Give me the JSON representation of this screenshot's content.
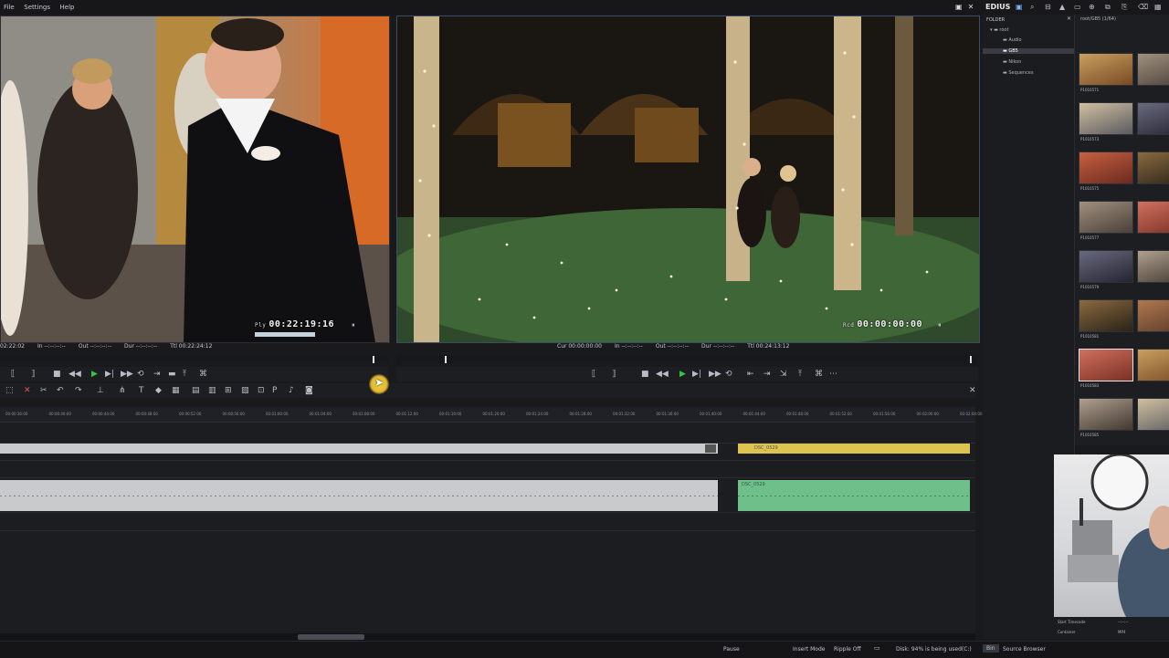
{
  "menu": [
    "File",
    "Settings",
    "Help"
  ],
  "player": {
    "timecode_label": "Ply",
    "timecode": "00:22:19:16",
    "info": [
      "02:22:02",
      "In --:--:--:--",
      "Out --:--:--:--",
      "Dur --:--:--:--",
      "Ttl 00:22:24:12"
    ]
  },
  "recorder": {
    "timecode_label": "Rcd",
    "timecode": "00:00:00:00",
    "info": [
      "Cur 00:00:00:00",
      "In --:--:--:--",
      "Out --:--:--:--",
      "Dur --:--:--:--",
      "Ttl 00:24:13:12"
    ]
  },
  "timeline": {
    "ruler": [
      "00:00:36:00",
      "00:00:40:00",
      "00:00:44:00",
      "00:00:48:00",
      "00:00:52:00",
      "00:00:56:00",
      "00:01:00:00",
      "00:01:04:00",
      "00:01:08:00",
      "00:01:12:00",
      "00:01:16:00",
      "00:01:20:00",
      "00:01:24:00",
      "00:01:28:00",
      "00:01:32:00",
      "00:01:36:00",
      "00:01:40:00",
      "00:01:44:00",
      "00:01:48:00",
      "00:01:52:00",
      "00:01:56:00",
      "00:02:00:00",
      "00:02:04:00"
    ],
    "clip_video_label": "DSC_0529",
    "clip_audio_label": "DSC_0529"
  },
  "bin": {
    "brand": "EDIUS",
    "folder_title": "FOLDER",
    "path": "root/GB5 (1/64)",
    "folders": [
      "root",
      "Audio",
      "GB5",
      "Nikon",
      "Sequences"
    ],
    "clips": [
      "P1010571",
      "P1010573",
      "P1010575",
      "P1010577",
      "P1010579",
      "P1010581",
      "P1010583",
      "P1010585",
      "P1010587"
    ],
    "props": [
      {
        "key": "Start Timecode",
        "value": "--:--:--"
      },
      {
        "key": "Container",
        "value": "MP4"
      }
    ]
  },
  "status": {
    "pause": "Pause",
    "insert_mode": "Insert Mode",
    "ripple": "Ripple Off",
    "disk": "Disk: 94% is being used(C:)",
    "tab_bin": "Bin",
    "tab_source": "Source Browser"
  }
}
